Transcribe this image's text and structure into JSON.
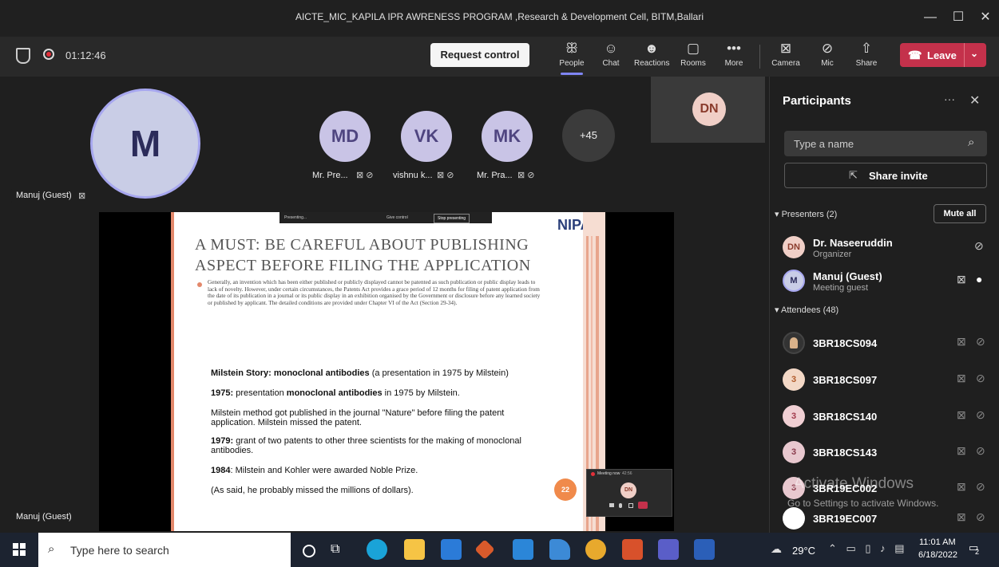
{
  "window": {
    "title": "AICTE_MIC_KAPILA IPR AWRENESS PROGRAM ,Research & Development Cell, BITM,Ballari",
    "minimize": "—",
    "maximize": "☐",
    "close": "✕"
  },
  "toolbar": {
    "timer": "01:12:46",
    "request_control": "Request control",
    "buttons": [
      {
        "label": "People",
        "icon": "people-icon"
      },
      {
        "label": "Chat",
        "icon": "chat-icon"
      },
      {
        "label": "Reactions",
        "icon": "reactions-icon"
      },
      {
        "label": "Rooms",
        "icon": "rooms-icon"
      },
      {
        "label": "More",
        "icon": "more-icon"
      },
      {
        "label": "Camera",
        "icon": "camera-off-icon"
      },
      {
        "label": "Mic",
        "icon": "mic-off-icon"
      },
      {
        "label": "Share",
        "icon": "share-icon"
      }
    ],
    "leave": "Leave"
  },
  "stage": {
    "self": {
      "initials": "M",
      "name": "Manuj (Guest)"
    },
    "tiles": [
      {
        "initials": "MD",
        "name": "Mr. Pre..."
      },
      {
        "initials": "VK",
        "name": "vishnu k..."
      },
      {
        "initials": "MK",
        "name": "Mr. Pra..."
      }
    ],
    "overflow": "+45",
    "dn_tile": "DN",
    "bottom_name": "Manuj (Guest)"
  },
  "slide": {
    "presenting_bar": {
      "presenting": "Presenting...",
      "give_control": "Give control",
      "stop": "Stop presenting"
    },
    "logo": "NIPAM",
    "title_line1": "A MUST: BE CAREFUL ABOUT PUBLISHING",
    "title_line2": "ASPECT BEFORE FILING THE APPLICATION",
    "bullet": "Generally, an invention which has been either published or publicly displayed cannot be patented as such publication or public display leads to lack of novelty. However, under certain circumstances, the Patents Act provides a grace period of 12 months for filing of patent application from the date of its publication in a journal or its public display in an exhibition organised by the Government or disclosure before any learned society or published by applicant. The detailed conditions are provided under Chapter VI of the Act (Section 29-34).",
    "milstein_bold": "Milstein Story: monoclonal antibodies",
    "milstein_rest": " (a presentation in 1975 by Milstein)",
    "p1975_bold": "1975:",
    "p1975_rest": " presentation ",
    "p1975_bold2": "monoclonal antibodies",
    "p1975_rest2": " in 1975 by Milstein.",
    "p_method": "Milstein method got published in the journal \"Nature\" before filing the patent application. Milstein missed the patent.",
    "p1979_bold": "1979:",
    "p1979_rest": " grant of two patents to other three scientists for the making of monoclonal antibodies.",
    "p1984_bold": "1984",
    "p1984_rest": ": Milstein and Kohler were awarded Noble Prize.",
    "p_said": "(As said, he probably missed the millions of dollars).",
    "page_num": "22",
    "mini_meeting": "Meeting now",
    "mini_time": "42:56",
    "mini_dn": "DN"
  },
  "panel": {
    "title": "Participants",
    "search_placeholder": "Type a name",
    "share_invite": "Share invite",
    "presenters_header": "Presenters (2)",
    "mute_all": "Mute all",
    "presenters": [
      {
        "initials": "DN",
        "name": "Dr. Naseeruddin",
        "role": "Organizer"
      },
      {
        "initials": "M",
        "name": "Manuj (Guest)",
        "role": "Meeting guest"
      }
    ],
    "attendees_header": "Attendees (48)",
    "attendees": [
      {
        "initials": "",
        "name": "3BR18CS094"
      },
      {
        "initials": "3",
        "name": "3BR18CS097"
      },
      {
        "initials": "3",
        "name": "3BR18CS140"
      },
      {
        "initials": "3",
        "name": "3BR18CS143"
      },
      {
        "initials": "3",
        "name": "3BR19EC002"
      },
      {
        "initials": "",
        "name": "3BR19EC007"
      }
    ],
    "activate_title": "Activate Windows",
    "activate_sub": "Go to Settings to activate Windows."
  },
  "taskbar": {
    "search": "Type here to search",
    "weather": "29°C",
    "time": "11:01 AM",
    "date": "6/18/2022",
    "notif_count": "2"
  }
}
